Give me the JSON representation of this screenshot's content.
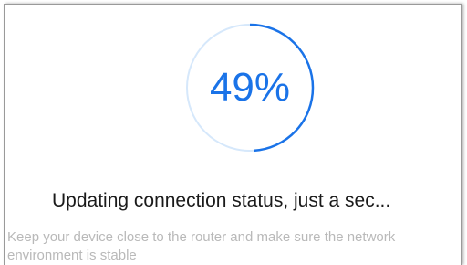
{
  "progress": {
    "percent": 49,
    "label": "49%",
    "track_color": "#d6e8fb",
    "fill_color": "#1a73e8"
  },
  "status": {
    "title": "Updating connection status, just a sec...",
    "hint": "Keep your device close to the router and make sure the network environment is stable"
  }
}
